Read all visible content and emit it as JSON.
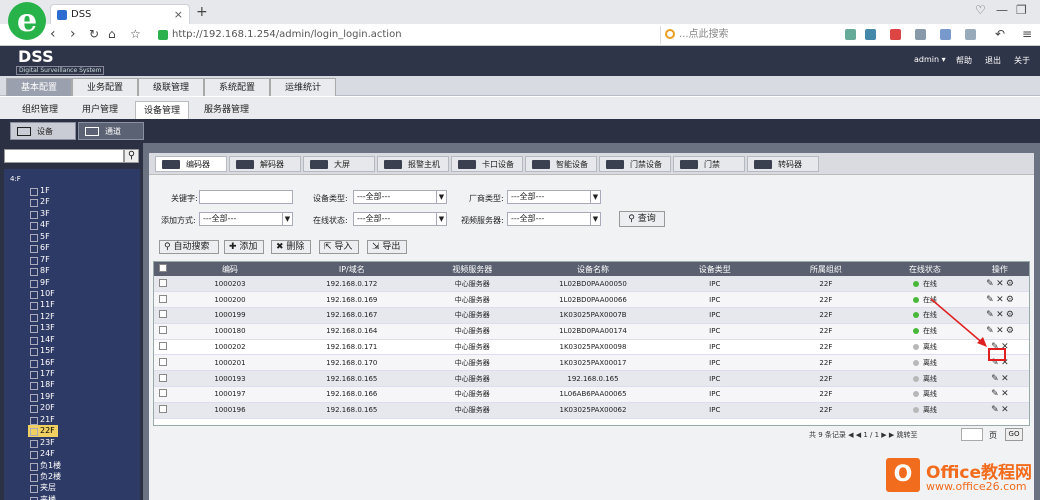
{
  "browser": {
    "tab_title": "DSS",
    "url": "http://192.168.1.254/admin/login_login.action",
    "search_placeholder": "...点此搜索",
    "logo_letter": "e"
  },
  "app": {
    "name": "DSS",
    "subtitle": "Digital Surveillance System",
    "user": "admin ▾",
    "links": [
      "帮助",
      "退出",
      "关于"
    ]
  },
  "main_tabs": [
    "基本配置",
    "业务配置",
    "级联管理",
    "系统配置",
    "运维统计"
  ],
  "sub_tabs": [
    "组织管理",
    "用户管理",
    "设备管理",
    "服务器管理"
  ],
  "device_toggle": [
    "设备",
    "通道"
  ],
  "tree": {
    "root": "4:F",
    "items": [
      "1F",
      "2F",
      "3F",
      "4F",
      "5F",
      "6F",
      "7F",
      "8F",
      "9F",
      "10F",
      "11F",
      "12F",
      "13F",
      "14F",
      "15F",
      "16F",
      "17F",
      "18F",
      "19F",
      "20F",
      "21F",
      "22F",
      "23F",
      "24F",
      "负1楼",
      "负2楼",
      "夹层",
      "夹楼"
    ],
    "selected": "22F"
  },
  "type_tabs": [
    "编码器",
    "解码器",
    "大屏",
    "报警主机",
    "卡口设备",
    "智能设备",
    "门禁设备",
    "门禁",
    "转码器"
  ],
  "filters": {
    "keyword_label": "关键字:",
    "device_type_label": "设备类型:",
    "device_type_value": "---全部---",
    "vendor_label": "厂商类型:",
    "vendor_value": "---全部---",
    "add_mode_label": "添加方式:",
    "add_mode_value": "---全部---",
    "online_label": "在线状态:",
    "online_value": "---全部---",
    "video_server_label": "视频服务器:",
    "video_server_value": "---全部---",
    "query": "查询"
  },
  "actions": [
    "自动搜索",
    "添加",
    "删除",
    "导入",
    "导出"
  ],
  "table": {
    "headers": [
      "编码",
      "IP/域名",
      "视频服务器",
      "设备名称",
      "设备类型",
      "所属组织",
      "在线状态",
      "操作"
    ],
    "rows": [
      [
        "1000203",
        "192.168.0.172",
        "中心服务器",
        "1L02BD0PAA00050",
        "IPC",
        "22F",
        "在线"
      ],
      [
        "1000200",
        "192.168.0.169",
        "中心服务器",
        "1L02BD0PAA00066",
        "IPC",
        "22F",
        "在线"
      ],
      [
        "1000199",
        "192.168.0.167",
        "中心服务器",
        "1K03025PAX0007B",
        "IPC",
        "22F",
        "在线"
      ],
      [
        "1000180",
        "192.168.0.164",
        "中心服务器",
        "1L02BD0PAA00174",
        "IPC",
        "22F",
        "在线"
      ],
      [
        "1000202",
        "192.168.0.171",
        "中心服务器",
        "1K03025PAX00098",
        "IPC",
        "22F",
        "离线"
      ],
      [
        "1000201",
        "192.168.0.170",
        "中心服务器",
        "1K03025PAX00017",
        "IPC",
        "22F",
        "离线"
      ],
      [
        "1000193",
        "192.168.0.165",
        "中心服务器",
        "192.168.0.165",
        "IPC",
        "22F",
        "离线"
      ],
      [
        "1000197",
        "192.168.0.166",
        "中心服务器",
        "1L06AB6PAA00065",
        "IPC",
        "22F",
        "离线"
      ],
      [
        "1000196",
        "192.168.0.165",
        "中心服务器",
        "1K03025PAX00062",
        "IPC",
        "22F",
        "离线"
      ]
    ]
  },
  "pager": {
    "text": "共 9 条记录  ◀ ◀ 1 / 1 ▶ ▶ 跳转至",
    "unit": "页",
    "go": "GO"
  },
  "watermark": {
    "logo": "O",
    "line1": "Office教程网",
    "line2": "www.office26.com"
  },
  "colors": {
    "online": "#48b838",
    "offline": "#b8b8b8",
    "highlight": "#e02020",
    "header_bg": "#2f3548"
  }
}
